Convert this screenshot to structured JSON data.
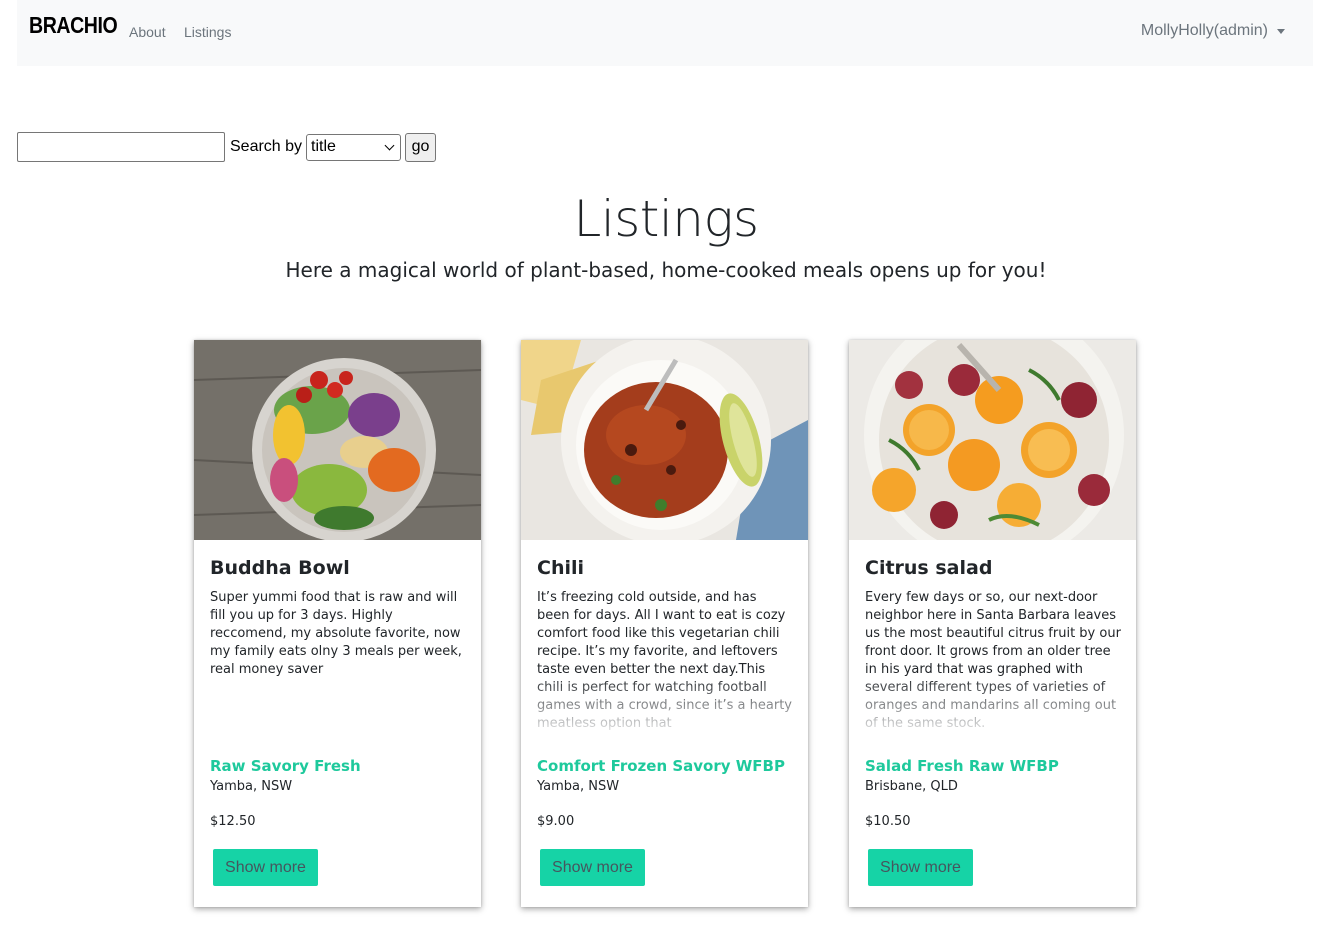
{
  "navbar": {
    "brand": "BRACHIO",
    "links": [
      "About",
      "Listings"
    ],
    "user": "MollyHolly(admin)"
  },
  "search": {
    "value": "",
    "label": "Search by",
    "selected": "title",
    "go_label": "go"
  },
  "page": {
    "title": "Listings",
    "subtitle": "Here a magical world of plant-based, home-cooked meals opens up for you!"
  },
  "cards": [
    {
      "title": "Buddha Bowl",
      "description": "Super yummi food that is raw and will fill you up for 3 days. Highly reccomend, my absolute favorite, now my family eats olny 3 meals per week, real money saver",
      "tags": "Raw Savory Fresh",
      "location": "Yamba, NSW",
      "price": "$12.50",
      "button": "Show more",
      "image": "buddha-bowl-photo"
    },
    {
      "title": "Chili",
      "description": "It’s freezing cold outside, and has been for days. All I want to eat is cozy comfort food like this vegetarian chili recipe. It’s my favorite, and leftovers taste even better the next day.This chili is perfect for watching football games with a crowd, since it’s a hearty meatless option that",
      "tags": "Comfort Frozen Savory WFBP",
      "location": "Yamba, NSW",
      "price": "$9.00",
      "button": "Show more",
      "image": "chili-photo"
    },
    {
      "title": "Citrus salad",
      "description": "Every few days or so, our next-door neighbor here in Santa Barbara leaves us the most beautiful citrus fruit by our front door. It grows from an older tree in his yard that was graphed with several different types of varieties of oranges and mandarins all coming out of the same stock.",
      "tags": "Salad Fresh Raw WFBP",
      "location": "Brisbane, QLD",
      "price": "$10.50",
      "button": "Show more",
      "image": "citrus-salad-photo"
    }
  ],
  "colors": {
    "navbar_bg": "#f8f9fa",
    "accent": "#16d3a6",
    "tag_text": "#1ec99c"
  }
}
